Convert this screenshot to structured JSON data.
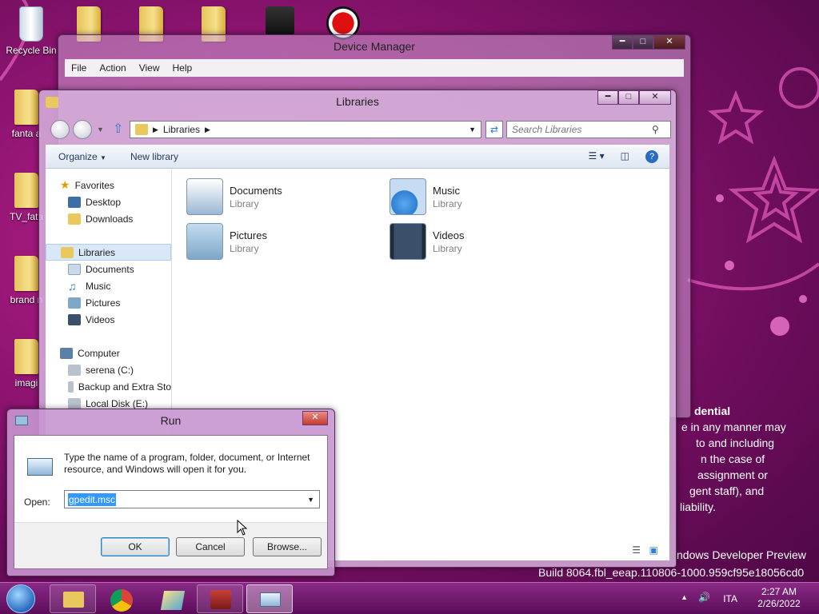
{
  "desktop": {
    "icons": [
      {
        "label": "Recycle Bin"
      },
      {
        "label": "fanta a"
      },
      {
        "label": "TV_fata"
      },
      {
        "label": "brand n"
      },
      {
        "label": "imagi"
      }
    ],
    "watermark": {
      "lines": [
        "dential",
        "e in any manner may",
        "to and including",
        "n the case of",
        "assignment or",
        "gent staff), and",
        "liability."
      ],
      "preview": "ndows Developer Preview",
      "build": "Build 8064.fbl_eeap.110806-1000.959cf95e18056cd0"
    }
  },
  "device_manager": {
    "title": "Device Manager",
    "menu": [
      "File",
      "Action",
      "View",
      "Help"
    ]
  },
  "libraries": {
    "title": "Libraries",
    "breadcrumb": "Libraries",
    "search_placeholder": "Search Libraries",
    "toolbar": {
      "organize": "Organize",
      "new_library": "New library"
    },
    "sidebar": {
      "favorites": "Favorites",
      "favorites_items": [
        "Desktop",
        "Downloads"
      ],
      "libraries": "Libraries",
      "libraries_items": [
        "Documents",
        "Music",
        "Pictures",
        "Videos"
      ],
      "computer": "Computer",
      "computer_items": [
        "serena (C:)",
        "Backup and Extra Sto",
        "Local Disk (E:)"
      ]
    },
    "items": [
      {
        "name": "Documents",
        "type": "Library",
        "color": "#9bb7d4"
      },
      {
        "name": "Music",
        "type": "Library",
        "color": "#2f7fd2"
      },
      {
        "name": "Pictures",
        "type": "Library",
        "color": "#7fa7c8"
      },
      {
        "name": "Videos",
        "type": "Library",
        "color": "#3a4f6a"
      }
    ]
  },
  "run": {
    "title": "Run",
    "description": "Type the name of a program, folder, document, or Internet resource, and Windows will open it for you.",
    "open_label": "Open:",
    "open_value": "gpedit.msc",
    "buttons": {
      "ok": "OK",
      "cancel": "Cancel",
      "browse": "Browse..."
    }
  },
  "taskbar": {
    "language": "ITA",
    "time": "2:27 AM",
    "date": "2/26/2022"
  }
}
